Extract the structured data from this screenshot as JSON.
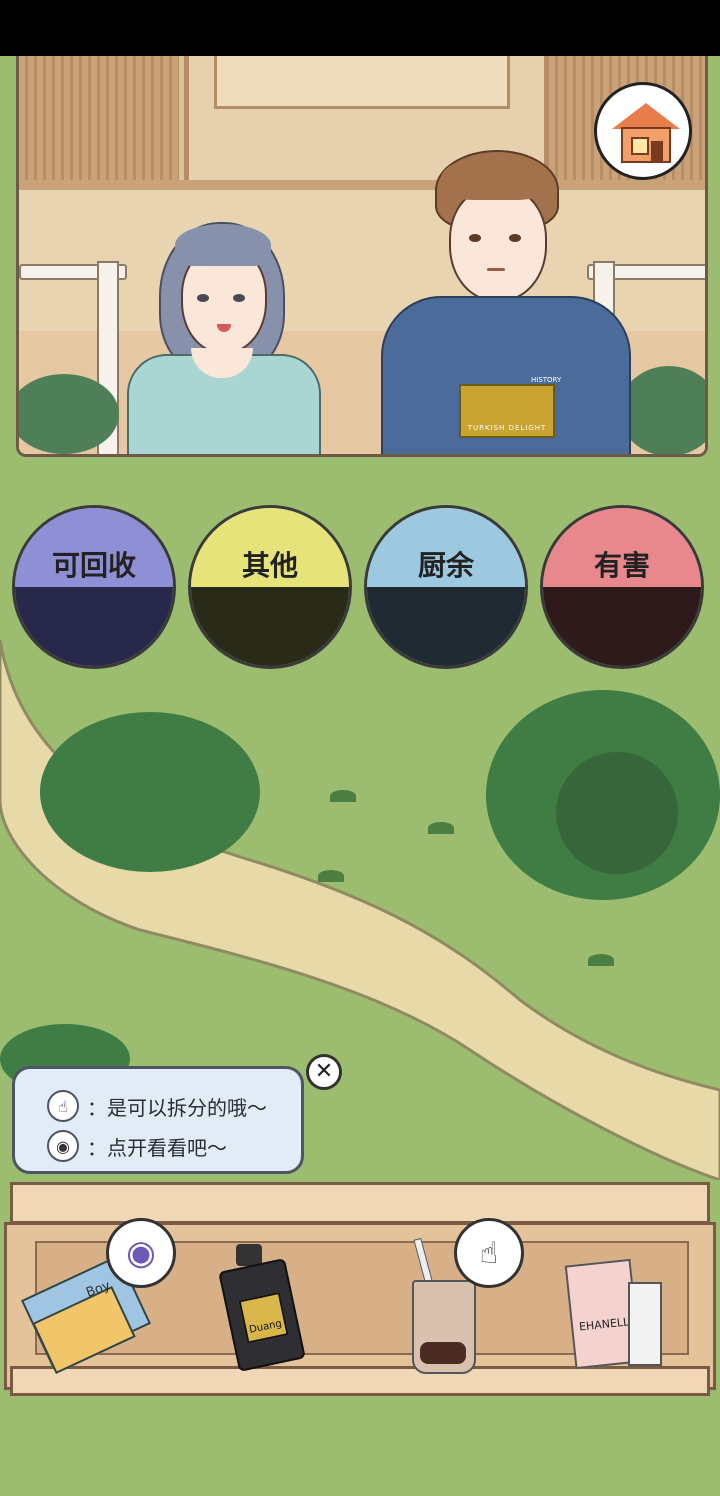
{
  "bins": [
    {
      "label": "可回收",
      "lid_color": "#8e8fd4",
      "hole_color": "#28284a"
    },
    {
      "label": "其他",
      "lid_color": "#e6e37a",
      "hole_color": "#2a2a18"
    },
    {
      "label": "厨余",
      "lid_color": "#9cc9e0",
      "hole_color": "#1f2a32"
    },
    {
      "label": "有害",
      "lid_color": "#e8888c",
      "hole_color": "#2e1a1a"
    }
  ],
  "hint": {
    "line1": "：是可以拆分的哦～",
    "line2": "：点开看看吧～"
  },
  "shirt_text": {
    "history": "HISTORY",
    "logo": "TURKISH DELIGHT"
  },
  "items": [
    {
      "name": "magazine",
      "text": "Boy"
    },
    {
      "name": "lotion-bottle",
      "text": "Duang"
    },
    {
      "name": "bubble-tea",
      "text": ""
    },
    {
      "name": "shopping-bag",
      "text": "EHANELL"
    }
  ],
  "icons": {
    "home": "home-icon",
    "close": "close-icon",
    "eye": "eye-icon",
    "tap": "tap-icon"
  }
}
